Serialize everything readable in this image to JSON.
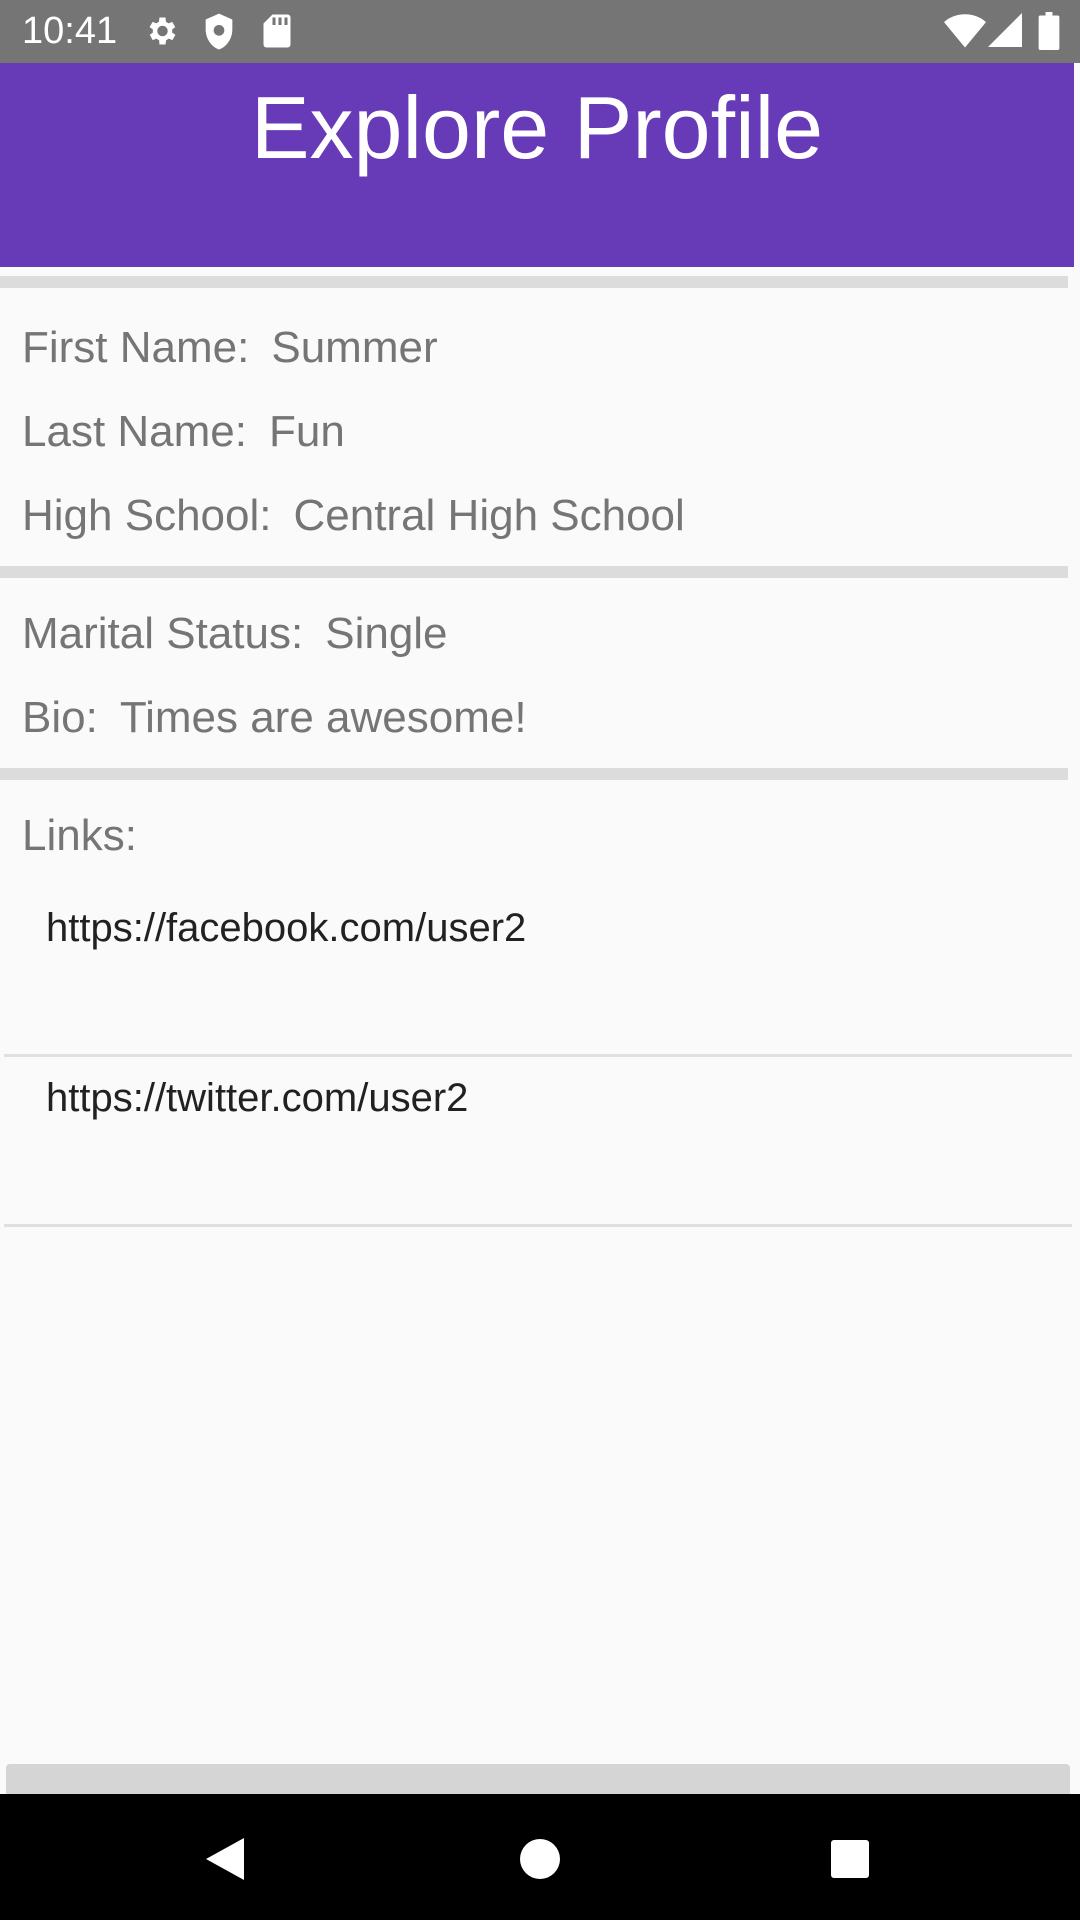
{
  "status_bar": {
    "time": "10:41",
    "icons_left": [
      "gear-icon",
      "shield-icon",
      "sd-card-icon"
    ],
    "icons_right": [
      "wifi-icon",
      "signal-icon",
      "battery-icon"
    ],
    "background": "#757575"
  },
  "app_bar": {
    "title": "Explore Profile",
    "background": "#673ab7"
  },
  "profile": {
    "first_name": {
      "label": "First Name:",
      "value": "Summer"
    },
    "last_name": {
      "label": "Last Name:",
      "value": "Fun"
    },
    "high_school": {
      "label": "High School:",
      "value": "Central High School"
    },
    "marital_status": {
      "label": "Marital Status:",
      "value": "Single"
    },
    "bio": {
      "label": "Bio:",
      "value": "Times are awesome!"
    }
  },
  "links": {
    "label": "Links:",
    "items": [
      "https://facebook.com/user2",
      "https://twitter.com/user2"
    ]
  },
  "nav_bar": {
    "buttons": [
      "back-icon",
      "home-icon",
      "recents-icon"
    ]
  }
}
